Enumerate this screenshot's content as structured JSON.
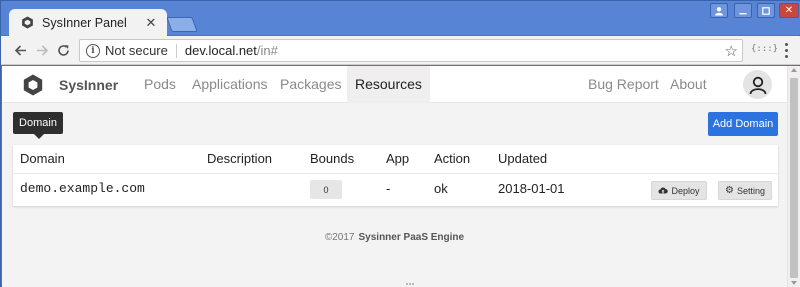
{
  "browser": {
    "tab_title": "SysInner Panel",
    "security_label": "Not secure",
    "url_host": "dev.local.net",
    "url_path": "/in#",
    "extension_label": "{:::}"
  },
  "navbar": {
    "brand": "SysInner",
    "items": [
      {
        "label": "Pods"
      },
      {
        "label": "Applications"
      },
      {
        "label": "Packages"
      },
      {
        "label": "Resources",
        "active": true
      }
    ],
    "right_items": [
      {
        "label": "Bug Report"
      },
      {
        "label": "About"
      }
    ]
  },
  "tooltip": "Domain",
  "add_button": "Add Domain",
  "table": {
    "columns": [
      "Domain",
      "Description",
      "Bounds",
      "App",
      "Action",
      "Updated"
    ],
    "rows": [
      {
        "domain": "demo.example.com",
        "description": "",
        "bounds": "0",
        "app": "-",
        "action": "ok",
        "updated": "2018-01-01",
        "deploy_label": "Deploy",
        "setting_label": "Setting"
      }
    ]
  },
  "footer": {
    "copyright": "©2017",
    "engine": "Sysinner PaaS Engine"
  },
  "colors": {
    "chrome_blue": "#4a76c9",
    "primary": "#2c73e0",
    "page_bg": "#f3f3f3"
  }
}
